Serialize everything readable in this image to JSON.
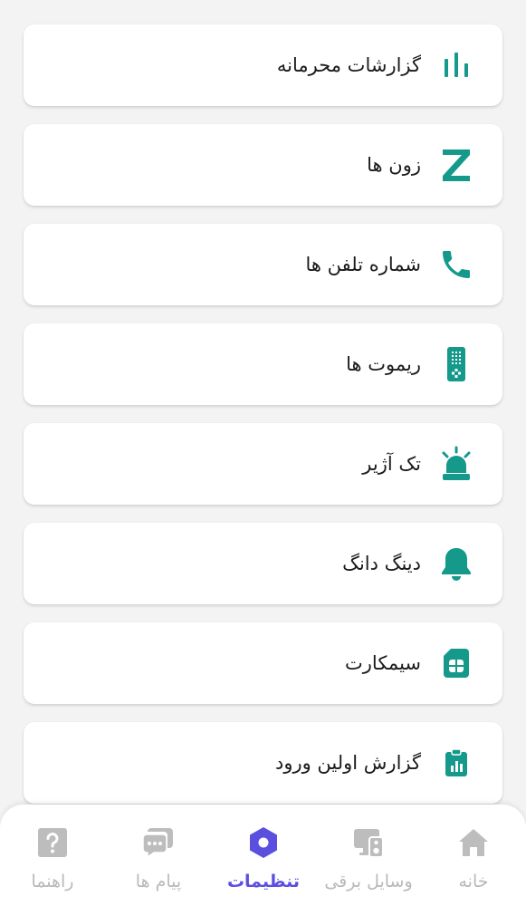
{
  "colors": {
    "accent_teal": "#14998a",
    "nav_active": "#5b4fe0",
    "nav_inactive": "#b9b9b9"
  },
  "menu": {
    "items": [
      {
        "label": "گزارشات محرمانه",
        "icon": "bar-chart-icon"
      },
      {
        "label": "زون ها",
        "icon": "zone-z-icon"
      },
      {
        "label": "شماره تلفن ها",
        "icon": "phone-icon"
      },
      {
        "label": "ریموت ها",
        "icon": "remote-icon"
      },
      {
        "label": "تک آژیر",
        "icon": "siren-icon"
      },
      {
        "label": "دینگ دانگ",
        "icon": "bell-icon"
      },
      {
        "label": "سیمکارت",
        "icon": "sim-card-icon"
      },
      {
        "label": "گزارش اولین ورود",
        "icon": "clipboard-report-icon"
      }
    ]
  },
  "bottom_nav": {
    "active": "تنظیمات",
    "items": [
      {
        "label": "خانه",
        "icon": "home-icon"
      },
      {
        "label": "وسایل برقی",
        "icon": "devices-icon"
      },
      {
        "label": "تنظیمات",
        "icon": "settings-hexagon-icon"
      },
      {
        "label": "پیام ها",
        "icon": "messages-icon"
      },
      {
        "label": "راهنما",
        "icon": "help-icon"
      }
    ]
  }
}
